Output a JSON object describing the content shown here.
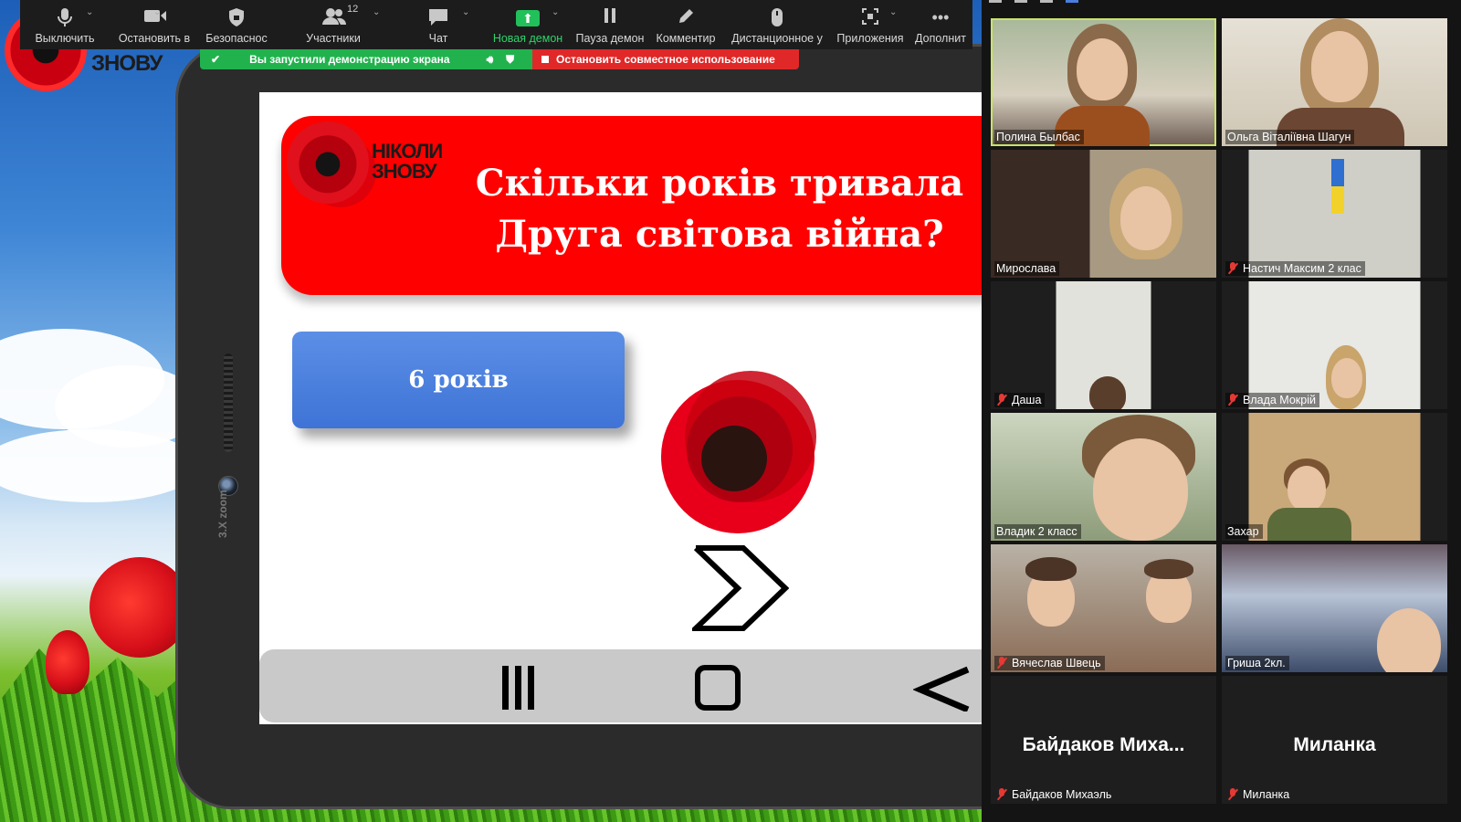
{
  "toolbar": {
    "items": [
      {
        "label": "Выключить",
        "icon": "microphone-icon"
      },
      {
        "label": "Остановить в",
        "icon": "video-camera-icon"
      },
      {
        "label": "Безопаснос",
        "icon": "shield-icon"
      },
      {
        "label": "Участники",
        "icon": "participants-icon",
        "count": "12"
      },
      {
        "label": "Чат",
        "icon": "chat-icon"
      },
      {
        "label": "Новая демон",
        "icon": "share-screen-icon"
      },
      {
        "label": "Пауза демон",
        "icon": "pause-icon"
      },
      {
        "label": "Комментир",
        "icon": "annotate-icon"
      },
      {
        "label": "Дистанционное у",
        "icon": "mouse-icon"
      },
      {
        "label": "Приложения",
        "icon": "apps-icon"
      },
      {
        "label": "Дополнит",
        "icon": "more-icon"
      }
    ],
    "accent_green": "#22c05a"
  },
  "share_banner": {
    "text": "Вы запустили демонстрацию экрана",
    "stop_label": "Остановить совместное использование"
  },
  "desktop": {
    "logo_text": "ЗНОВУ",
    "tablet_zoom": "3.X zoom"
  },
  "slide": {
    "logo_line1": "НІКОЛИ",
    "logo_line2": "ЗНОВУ",
    "title_line1": "Скільки років тривала",
    "title_line2": "Друга світова війна?",
    "answer": "6 років",
    "header_color": "#ff0000",
    "answer_color": "#4a80e0"
  },
  "gallery": {
    "participants": [
      {
        "name": "Полина Былбас",
        "muted": false,
        "active": true
      },
      {
        "name": "Ольга Віталіївна Шагун",
        "muted": false,
        "active": false
      },
      {
        "name": "Мирослава",
        "muted": false,
        "active": false
      },
      {
        "name": "Настич Максим 2 клас",
        "muted": true,
        "active": false
      },
      {
        "name": "Даша",
        "muted": true,
        "active": false
      },
      {
        "name": "Влада Мокрій",
        "muted": true,
        "active": false
      },
      {
        "name": "Владик 2 класс",
        "muted": false,
        "active": false
      },
      {
        "name": "Захар",
        "muted": false,
        "active": false
      },
      {
        "name": "Вячеслав Швець",
        "muted": true,
        "active": false
      },
      {
        "name": "Гриша 2кл.",
        "muted": false,
        "active": false
      },
      {
        "name": "Байдаков Михаэль",
        "display": "Байдаков  Миха...",
        "muted": true,
        "active": false
      },
      {
        "name": "Миланка",
        "display": "Миланка",
        "muted": true,
        "active": false
      }
    ]
  }
}
